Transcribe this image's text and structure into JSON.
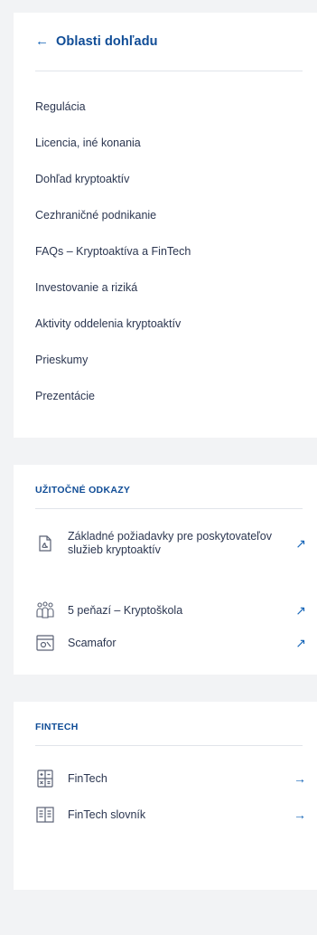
{
  "nav": {
    "back_arrow": "←",
    "title": "Oblasti dohľadu",
    "items": [
      {
        "label": "Regulácia"
      },
      {
        "label": "Licencia, iné konania"
      },
      {
        "label": "Dohľad kryptoaktív"
      },
      {
        "label": "Cezhraničné podnikanie"
      },
      {
        "label": "FAQs – Kryptoaktíva a FinTech"
      },
      {
        "label": "Investovanie a riziká"
      },
      {
        "label": "Aktivity oddelenia kryptoaktív"
      },
      {
        "label": "Prieskumy"
      },
      {
        "label": "Prezentácie"
      }
    ]
  },
  "useful_links": {
    "title": "UŽITOČNÉ ODKAZY",
    "external_arrow": "↗",
    "items": [
      {
        "label": "Základné požiadavky pre poskytovateľov služieb kryptoaktív",
        "icon": "pdf-document-icon"
      },
      {
        "label": "5 peňazí – Kryptoškola",
        "icon": "people-group-icon"
      },
      {
        "label": "Scamafor",
        "icon": "browser-window-icon"
      }
    ]
  },
  "fintech": {
    "title": "FINTECH",
    "arrow": "→",
    "items": [
      {
        "label": "FinTech",
        "icon": "calculator-icon"
      },
      {
        "label": "FinTech slovník",
        "icon": "book-icon"
      }
    ]
  },
  "colors": {
    "accent": "#0f4c96",
    "link_arrow": "#1565b8",
    "text": "#2b3650",
    "background": "#f2f3f5",
    "panel": "#ffffff"
  }
}
